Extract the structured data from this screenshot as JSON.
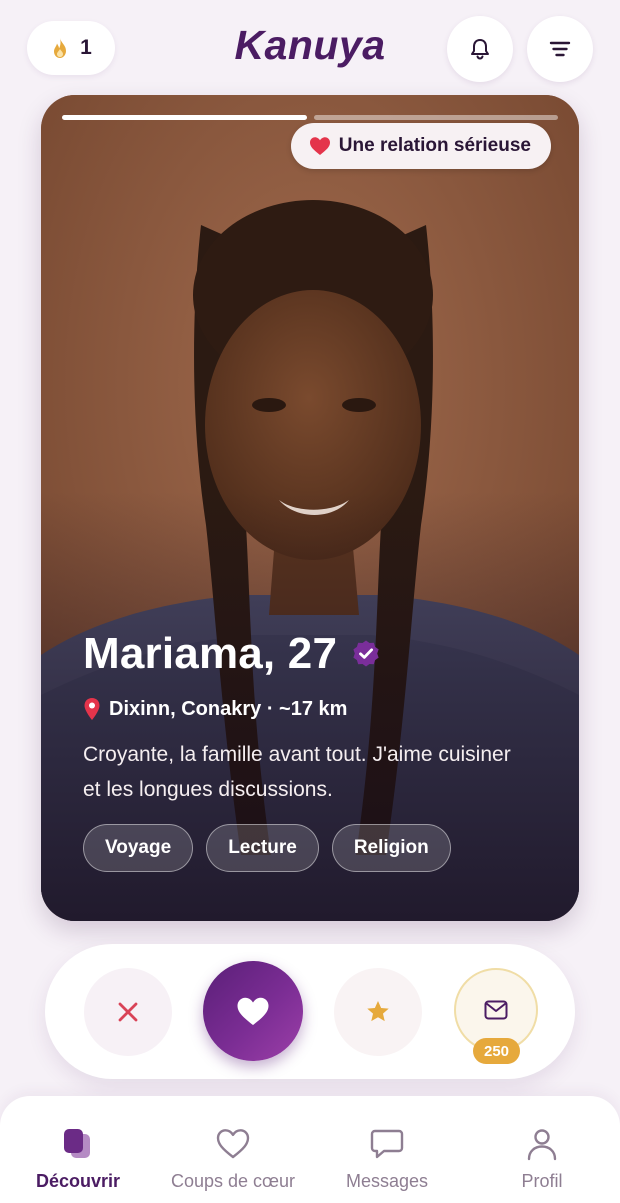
{
  "header": {
    "streak_count": "1",
    "app_name": "Kanuya",
    "icons": [
      "flame-icon",
      "bell-icon",
      "filter-icon"
    ]
  },
  "card": {
    "progress": {
      "total": 2,
      "current": 1
    },
    "intent": "Une relation sérieuse",
    "intent_icon": "heart-icon",
    "name_age": "Mariama, 27",
    "verified": true,
    "location": "Dixinn, Conakry · ~17 km",
    "bio": "Croyante, la famille avant tout. J'aime cuisiner et les longues discussions.",
    "tags": [
      "Voyage",
      "Lecture",
      "Religion"
    ]
  },
  "actions": {
    "buttons": [
      "pass-icon",
      "like-heart-icon",
      "super-like-star-icon",
      "message-envelope-icon"
    ],
    "message_cost": "250"
  },
  "nav": {
    "items": [
      {
        "label": "Découvrir",
        "icon": "discover-icon",
        "active": true
      },
      {
        "label": "Coups de cœur",
        "icon": "heart-outline-icon",
        "active": false
      },
      {
        "label": "Messages",
        "icon": "chat-bubble-icon",
        "active": false
      },
      {
        "label": "Profil",
        "icon": "person-icon",
        "active": false
      }
    ]
  },
  "colors": {
    "brand": "#4b1c63",
    "accent_gradient_start": "#5a1f78",
    "accent_gradient_end": "#9c3fa8",
    "pass_red": "#d94357",
    "star_gold": "#e6a93c",
    "background": "#f6f1f7"
  }
}
